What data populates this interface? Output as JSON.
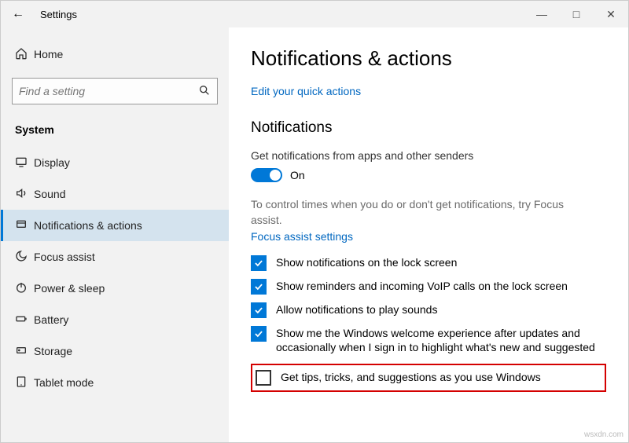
{
  "window": {
    "title": "Settings"
  },
  "sidebar": {
    "home": "Home",
    "search_placeholder": "Find a setting",
    "section": "System",
    "items": [
      {
        "label": "Display"
      },
      {
        "label": "Sound"
      },
      {
        "label": "Notifications & actions"
      },
      {
        "label": "Focus assist"
      },
      {
        "label": "Power & sleep"
      },
      {
        "label": "Battery"
      },
      {
        "label": "Storage"
      },
      {
        "label": "Tablet mode"
      }
    ]
  },
  "main": {
    "heading": "Notifications & actions",
    "quick_link": "Edit your quick actions",
    "subheading": "Notifications",
    "toggle_desc": "Get notifications from apps and other senders",
    "toggle_state": "On",
    "hint1": "To control times when you do or don't get notifications, try Focus assist.",
    "hint_link": "Focus assist settings",
    "checks": [
      {
        "label": "Show notifications on the lock screen",
        "checked": true
      },
      {
        "label": "Show reminders and incoming VoIP calls on the lock screen",
        "checked": true
      },
      {
        "label": "Allow notifications to play sounds",
        "checked": true
      },
      {
        "label": "Show me the Windows welcome experience after updates and occasionally when I sign in to highlight what's new and suggested",
        "checked": true
      },
      {
        "label": "Get tips, tricks, and suggestions as you use Windows",
        "checked": false,
        "highlighted": true
      }
    ]
  },
  "watermark": "wsxdn.com"
}
